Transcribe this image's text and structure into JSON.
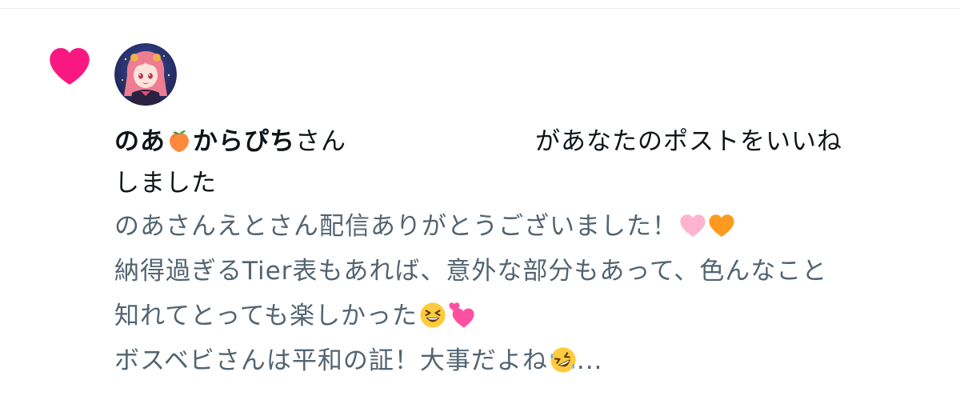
{
  "notification": {
    "type_icon": "heart-icon",
    "avatar_icon": "user-avatar",
    "user_name_part1": "のあ",
    "user_name_emoji": "peach-emoji",
    "user_name_part2": "からぴち",
    "honorific": "さん",
    "action_text_1": "があなたのポストをいいね",
    "action_text_2": "しました",
    "post_lines": [
      "のあさんえとさん配信ありがとうございました！",
      "納得過ぎるTier表もあれば、意外な部分もあって、色んなこと",
      "知れてとっても楽しかった",
      "ボスベビさんは平和の証！大事だよね"
    ],
    "post_line1_emojis": [
      "pink-heart-emoji",
      "orange-heart-emoji"
    ],
    "post_line3_emojis": [
      "grinning-squinting-face-emoji",
      "two-hearts-emoji"
    ],
    "post_line4_emoji": "rolling-on-floor-laughing-emoji",
    "post_ellipsis": "..."
  },
  "colors": {
    "heart": "#f91880",
    "primary_text": "#0f1419",
    "secondary_text": "#536471"
  }
}
